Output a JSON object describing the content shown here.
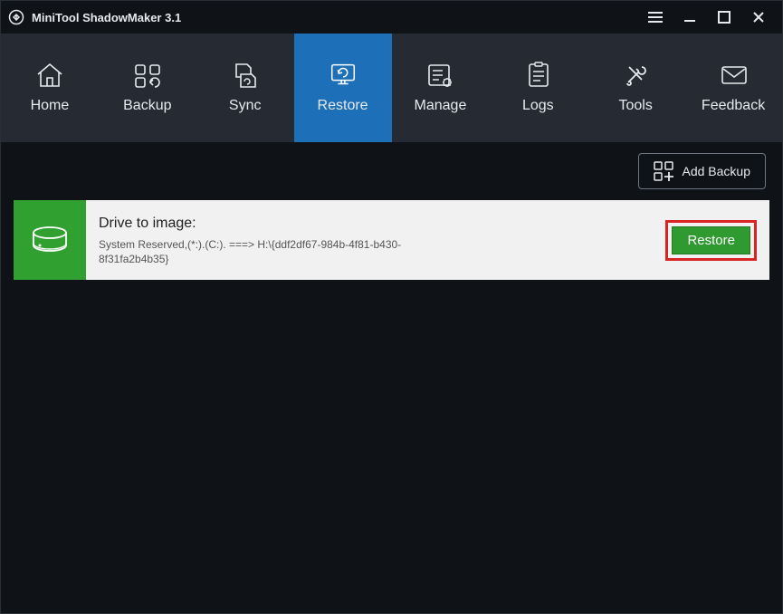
{
  "window": {
    "title": "MiniTool ShadowMaker 3.1"
  },
  "nav": {
    "items": [
      {
        "label": "Home"
      },
      {
        "label": "Backup"
      },
      {
        "label": "Sync"
      },
      {
        "label": "Restore"
      },
      {
        "label": "Manage"
      },
      {
        "label": "Logs"
      },
      {
        "label": "Tools"
      },
      {
        "label": "Feedback"
      }
    ],
    "active_index": 3
  },
  "toolbar": {
    "add_backup_label": "Add Backup"
  },
  "card": {
    "heading": "Drive to image:",
    "detail": "System Reserved,(*:).(C:). ===> H:\\{ddf2df67-984b-4f81-b430-8f31fa2b4b35}",
    "restore_label": "Restore"
  }
}
